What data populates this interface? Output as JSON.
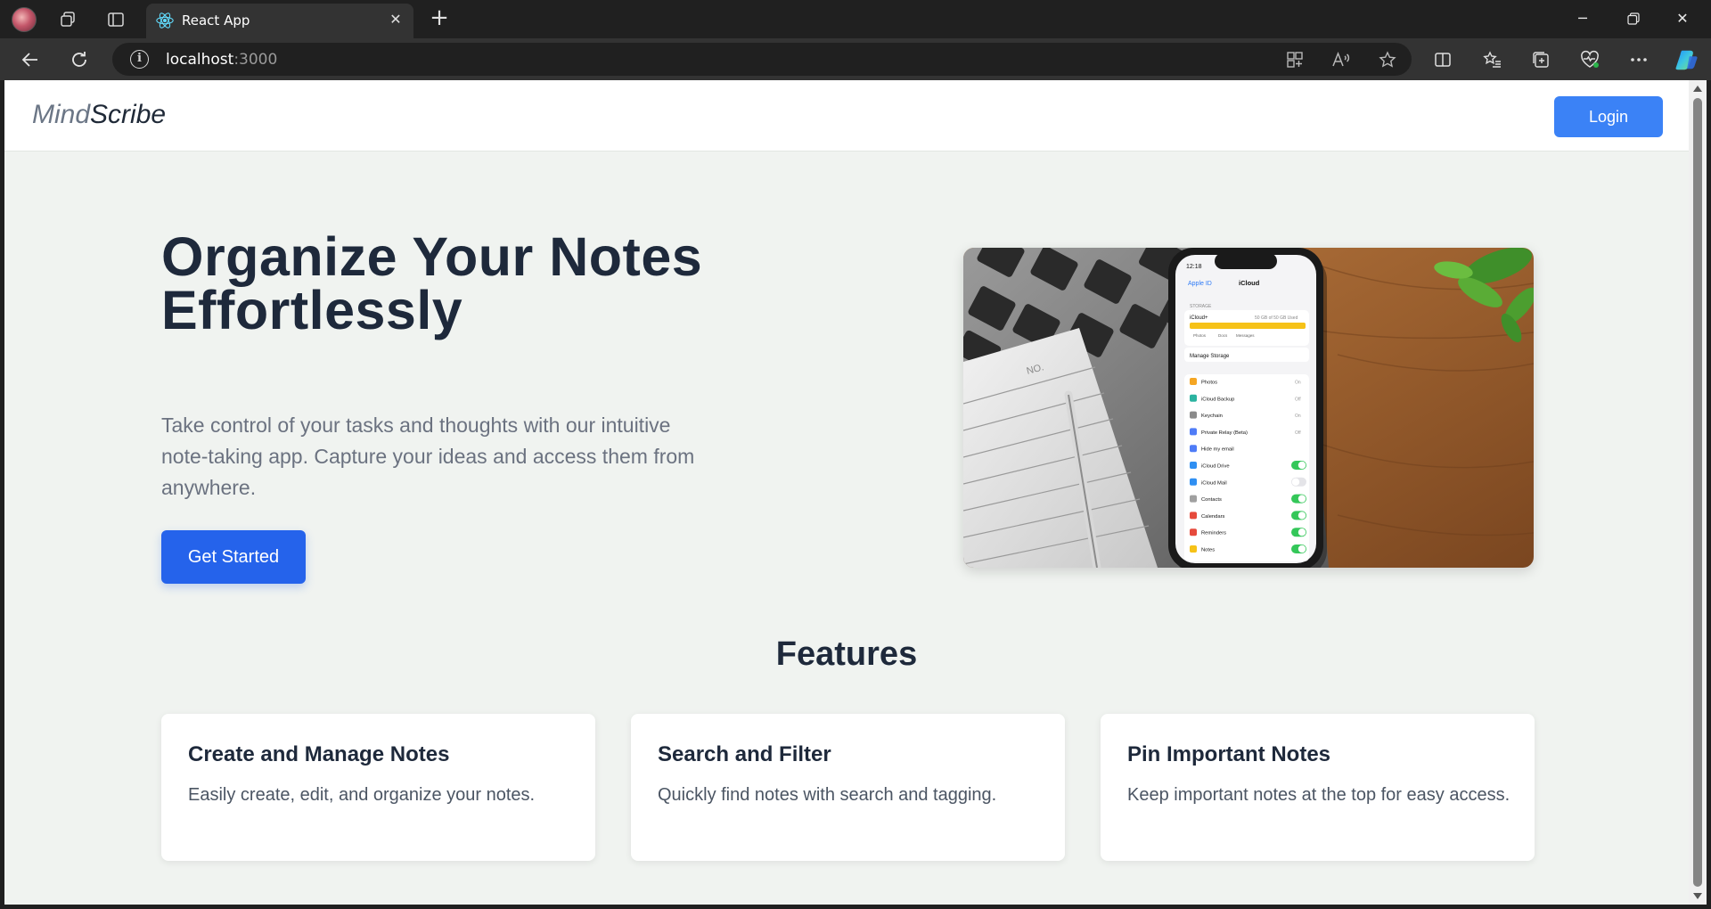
{
  "browser": {
    "tab_title": "React App",
    "url_host": "localhost",
    "url_port": ":3000"
  },
  "header": {
    "logo_part1": "Mind",
    "logo_part2": "Scribe",
    "login_label": "Login"
  },
  "hero": {
    "title": "Organize Your Notes Effortlessly",
    "description": "Take control of your tasks and thoughts with our intuitive note-taking app. Capture your ideas and access them from anywhere.",
    "cta_label": "Get Started"
  },
  "phone_screen": {
    "time": "12:18",
    "back_label": "Apple ID",
    "screen_title": "iCloud",
    "storage_label": "STORAGE",
    "storage_plan": "iCloud+",
    "storage_used": "50 GB of 50 GB Used",
    "legend": [
      "Photos",
      "Docs",
      "Messages"
    ],
    "manage_storage": "Manage Storage",
    "apps": [
      {
        "label": "Photos",
        "state": "On",
        "toggle": false
      },
      {
        "label": "iCloud Backup",
        "state": "Off",
        "toggle": false
      },
      {
        "label": "Keychain",
        "state": "On",
        "toggle": false
      },
      {
        "label": "Private Relay (Beta)",
        "state": "Off",
        "toggle": false
      },
      {
        "label": "Hide my email",
        "state": "",
        "toggle": false
      },
      {
        "label": "iCloud Drive",
        "state": "on",
        "toggle": true
      },
      {
        "label": "iCloud Mail",
        "state": "off",
        "toggle": true
      },
      {
        "label": "Contacts",
        "state": "on",
        "toggle": true
      },
      {
        "label": "Calendars",
        "state": "on",
        "toggle": true
      },
      {
        "label": "Reminders",
        "state": "on",
        "toggle": true
      },
      {
        "label": "Notes",
        "state": "on",
        "toggle": true
      }
    ],
    "notepad_label": "NO."
  },
  "features": {
    "title": "Features",
    "items": [
      {
        "title": "Create and Manage Notes",
        "description": "Easily create, edit, and organize your notes."
      },
      {
        "title": "Search and Filter",
        "description": "Quickly find notes with search and tagging."
      },
      {
        "title": "Pin Important Notes",
        "description": "Keep important notes at the top for easy access."
      }
    ]
  },
  "colors": {
    "primary": "#3b82f6",
    "cta": "#2563eb",
    "page_bg": "#f0f3f0",
    "heading": "#1e293b"
  }
}
